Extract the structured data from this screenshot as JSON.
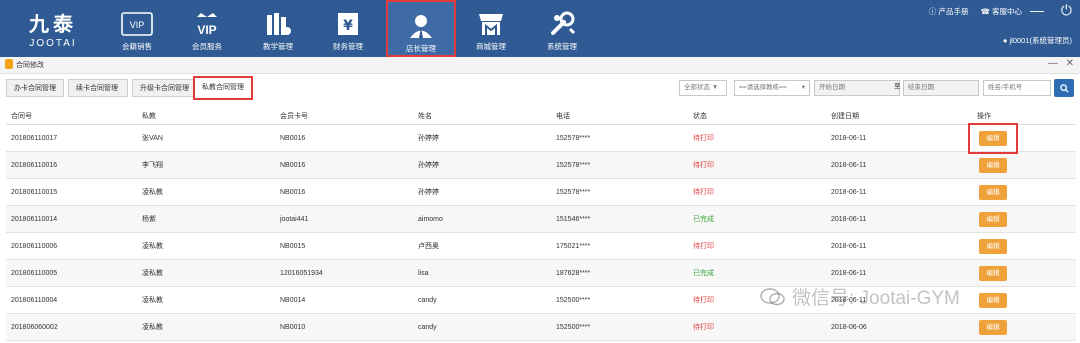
{
  "logo": {
    "cn": "九泰",
    "en": "JOOTAI"
  },
  "nav": [
    {
      "label": "会籍销售",
      "icon": "vip-card-icon"
    },
    {
      "label": "会员服务",
      "icon": "vip-crown-icon"
    },
    {
      "label": "教学管理",
      "icon": "books-icon"
    },
    {
      "label": "财务管理",
      "icon": "yen-icon"
    },
    {
      "label": "店长管理",
      "icon": "manager-icon"
    },
    {
      "label": "商城管理",
      "icon": "store-icon"
    },
    {
      "label": "系统管理",
      "icon": "wrench-icon"
    }
  ],
  "top_links": {
    "manual": "产品手册",
    "service": "客服中心"
  },
  "user": "jl0001(系统管理员)",
  "sub_window": {
    "title": "合同修改"
  },
  "tabs": [
    "办卡合同管理",
    "续卡合同管理",
    "升级卡合同管理",
    "私教合同管理"
  ],
  "filters": {
    "status": "全部状态",
    "coach": "==请选择教练==",
    "start_date": "开始日期",
    "to": "至",
    "end_date": "结束日期",
    "name_phone": "姓名/手机号"
  },
  "table": {
    "headers": [
      "合同号",
      "私教",
      "会员卡号",
      "姓名",
      "电话",
      "状态",
      "创建日期",
      "操作"
    ],
    "rows": [
      {
        "id": "201806110017",
        "coach": "张VAN",
        "card": "NB0016",
        "name": "孙婷婷",
        "phone": "152578****",
        "status": "待打印",
        "date": "2018-06-11",
        "action": "编辑"
      },
      {
        "id": "201806110016",
        "coach": "李飞翔",
        "card": "NB0016",
        "name": "孙婷婷",
        "phone": "152578****",
        "status": "待打印",
        "date": "2018-06-11",
        "action": "编辑"
      },
      {
        "id": "201806110015",
        "coach": "凌私教",
        "card": "NB0016",
        "name": "孙婷婷",
        "phone": "152578****",
        "status": "待打印",
        "date": "2018-06-11",
        "action": "编辑"
      },
      {
        "id": "201806110014",
        "coach": "杨紫",
        "card": "jootai441",
        "name": "aimomo",
        "phone": "151546****",
        "status": "已完成",
        "date": "2018-06-11",
        "action": "编辑"
      },
      {
        "id": "201806110006",
        "coach": "凌私教",
        "card": "NB0015",
        "name": "卢西奥",
        "phone": "175021****",
        "status": "待打印",
        "date": "2018-06-11",
        "action": "编辑"
      },
      {
        "id": "201806110005",
        "coach": "凌私教",
        "card": "12016051934",
        "name": "lisa",
        "phone": "187628****",
        "status": "已完成",
        "date": "2018-06-11",
        "action": "编辑"
      },
      {
        "id": "201806110004",
        "coach": "凌私教",
        "card": "NB0014",
        "name": "candy",
        "phone": "152500****",
        "status": "待打印",
        "date": "2018-06-11",
        "action": "编辑"
      },
      {
        "id": "201806060002",
        "coach": "凌私教",
        "card": "NB0010",
        "name": "candy",
        "phone": "152500****",
        "status": "待打印",
        "date": "2018-06-06",
        "action": "编辑"
      }
    ]
  },
  "watermark": "微信号: Jootai-GYM",
  "colors": {
    "nav_bg": "#2f5a93",
    "highlight": "#e23b3b",
    "edit_btn": "#f0a23a",
    "pending": "#e23b3b",
    "done": "#3aa43a"
  }
}
